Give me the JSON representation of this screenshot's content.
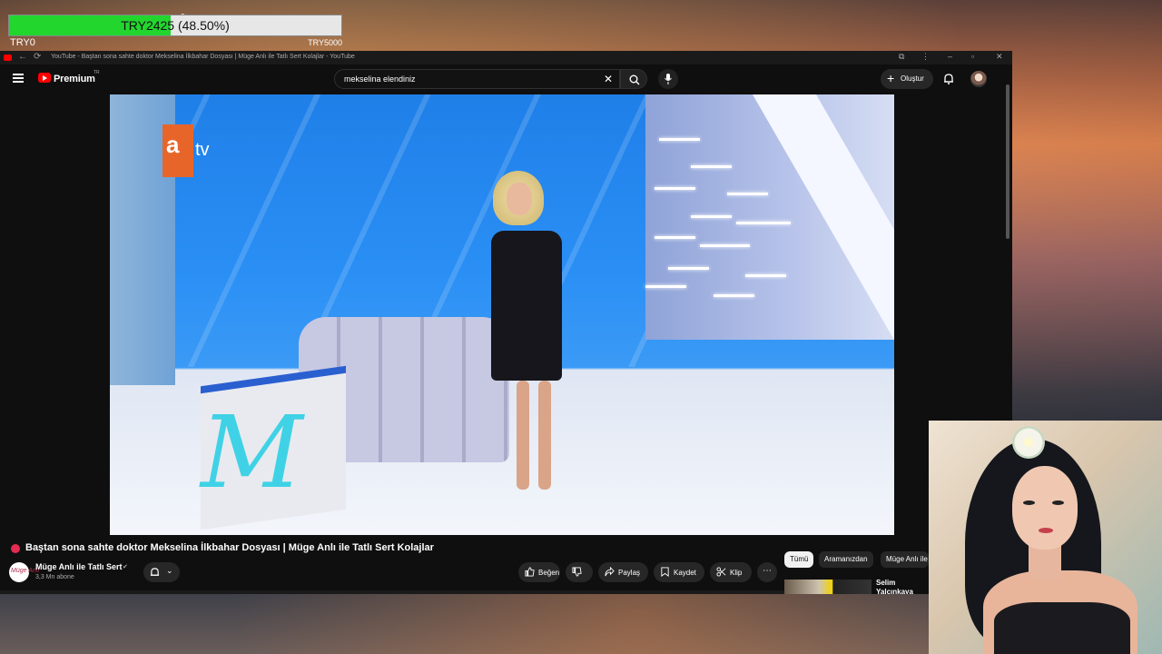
{
  "donation": {
    "question_mark": "?",
    "amount_text": "TRY2425 (48.50%)",
    "progress_percent": 48.5,
    "min_label": "TRY0",
    "max_label": "TRY5000"
  },
  "browser": {
    "tab_title": "YouTube - Baştan sona sahte doktor Mekselina İlkbahar Dosyası | Müge Anlı ile Tatlı Sert Kolajlar - YouTube"
  },
  "header": {
    "logo_text": "Premium",
    "region": "TR",
    "search_value": "mekselina elendiniz",
    "create_label": "Oluştur",
    "icons": [
      "menu-icon",
      "youtube-logo-icon",
      "clear-icon",
      "search-icon",
      "mic-icon",
      "plus-icon",
      "bell-icon"
    ]
  },
  "video": {
    "channel_logo_a": "a",
    "channel_logo_tv": "tv",
    "set_letter": "M",
    "title": "Baştan sona sahte doktor Mekselina İlkbahar Dosyası | Müge Anlı ile Tatlı Sert Kolajlar"
  },
  "channel": {
    "name": "Müge Anlı ile Tatlı Sert",
    "subscribers": "3,3 Mn abone",
    "avatar_text": "Müge Anlı"
  },
  "actions": {
    "like_label": "Beğen",
    "share_label": "Paylaş",
    "save_label": "Kaydet",
    "clip_label": "Klip",
    "more_label": "⋯"
  },
  "chips": [
    "Tümü",
    "Aramanızdan",
    "Müge Anlı ile"
  ],
  "recommendation": {
    "title": "Selim Yalçınkaya mesajları yüzün"
  },
  "colors": {
    "accent": "#ff0000",
    "progress": "#22d62e",
    "live_dot": "#e52b50"
  }
}
